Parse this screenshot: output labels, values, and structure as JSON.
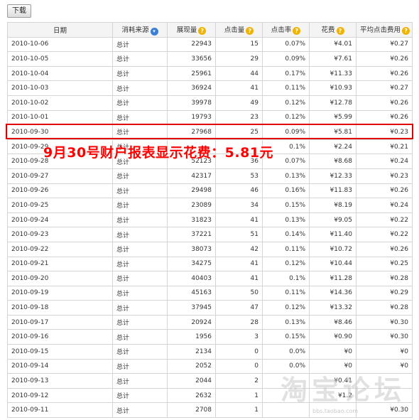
{
  "toolbar": {
    "download_label": "下载"
  },
  "table": {
    "headers": {
      "date": "日期",
      "source": "消耗来源",
      "impressions": "展现量",
      "clicks": "点击量",
      "ctr": "点击率",
      "cost": "花费",
      "avg_cpc": "平均点击费用"
    },
    "rows": [
      {
        "date": "2010-10-06",
        "source": "总计",
        "impressions": "22943",
        "clicks": "15",
        "ctr": "0.07%",
        "cost": "¥4.01",
        "avg_cpc": "¥0.27"
      },
      {
        "date": "2010-10-05",
        "source": "总计",
        "impressions": "33656",
        "clicks": "29",
        "ctr": "0.09%",
        "cost": "¥7.61",
        "avg_cpc": "¥0.26"
      },
      {
        "date": "2010-10-04",
        "source": "总计",
        "impressions": "25961",
        "clicks": "44",
        "ctr": "0.17%",
        "cost": "¥11.33",
        "avg_cpc": "¥0.26"
      },
      {
        "date": "2010-10-03",
        "source": "总计",
        "impressions": "36924",
        "clicks": "41",
        "ctr": "0.11%",
        "cost": "¥10.93",
        "avg_cpc": "¥0.27"
      },
      {
        "date": "2010-10-02",
        "source": "总计",
        "impressions": "39978",
        "clicks": "49",
        "ctr": "0.12%",
        "cost": "¥12.78",
        "avg_cpc": "¥0.26"
      },
      {
        "date": "2010-10-01",
        "source": "总计",
        "impressions": "19793",
        "clicks": "23",
        "ctr": "0.12%",
        "cost": "¥5.99",
        "avg_cpc": "¥0.26"
      },
      {
        "date": "2010-09-30",
        "source": "总计",
        "impressions": "27968",
        "clicks": "25",
        "ctr": "0.09%",
        "cost": "¥5.81",
        "avg_cpc": "¥0.23"
      },
      {
        "date": "2010-09-29",
        "source": "总计",
        "impressions": "",
        "clicks": "",
        "ctr": "0.1%",
        "cost": "¥2.24",
        "avg_cpc": "¥0.21"
      },
      {
        "date": "2010-09-28",
        "source": "总计",
        "impressions": "52123",
        "clicks": "36",
        "ctr": "0.07%",
        "cost": "¥8.68",
        "avg_cpc": "¥0.24"
      },
      {
        "date": "2010-09-27",
        "source": "总计",
        "impressions": "42317",
        "clicks": "53",
        "ctr": "0.13%",
        "cost": "¥12.33",
        "avg_cpc": "¥0.23"
      },
      {
        "date": "2010-09-26",
        "source": "总计",
        "impressions": "29498",
        "clicks": "46",
        "ctr": "0.16%",
        "cost": "¥11.83",
        "avg_cpc": "¥0.26"
      },
      {
        "date": "2010-09-25",
        "source": "总计",
        "impressions": "23089",
        "clicks": "34",
        "ctr": "0.15%",
        "cost": "¥8.19",
        "avg_cpc": "¥0.24"
      },
      {
        "date": "2010-09-24",
        "source": "总计",
        "impressions": "31823",
        "clicks": "41",
        "ctr": "0.13%",
        "cost": "¥9.05",
        "avg_cpc": "¥0.22"
      },
      {
        "date": "2010-09-23",
        "source": "总计",
        "impressions": "37221",
        "clicks": "51",
        "ctr": "0.14%",
        "cost": "¥11.40",
        "avg_cpc": "¥0.22"
      },
      {
        "date": "2010-09-22",
        "source": "总计",
        "impressions": "38073",
        "clicks": "42",
        "ctr": "0.11%",
        "cost": "¥10.72",
        "avg_cpc": "¥0.26"
      },
      {
        "date": "2010-09-21",
        "source": "总计",
        "impressions": "34275",
        "clicks": "41",
        "ctr": "0.12%",
        "cost": "¥10.44",
        "avg_cpc": "¥0.25"
      },
      {
        "date": "2010-09-20",
        "source": "总计",
        "impressions": "40403",
        "clicks": "41",
        "ctr": "0.1%",
        "cost": "¥11.28",
        "avg_cpc": "¥0.28"
      },
      {
        "date": "2010-09-19",
        "source": "总计",
        "impressions": "45163",
        "clicks": "50",
        "ctr": "0.11%",
        "cost": "¥14.36",
        "avg_cpc": "¥0.29"
      },
      {
        "date": "2010-09-18",
        "source": "总计",
        "impressions": "37945",
        "clicks": "47",
        "ctr": "0.12%",
        "cost": "¥13.32",
        "avg_cpc": "¥0.28"
      },
      {
        "date": "2010-09-17",
        "source": "总计",
        "impressions": "20924",
        "clicks": "28",
        "ctr": "0.13%",
        "cost": "¥8.46",
        "avg_cpc": "¥0.30"
      },
      {
        "date": "2010-09-16",
        "source": "总计",
        "impressions": "1956",
        "clicks": "3",
        "ctr": "0.15%",
        "cost": "¥0.90",
        "avg_cpc": "¥0.30"
      },
      {
        "date": "2010-09-15",
        "source": "总计",
        "impressions": "2134",
        "clicks": "0",
        "ctr": "0.0%",
        "cost": "¥0",
        "avg_cpc": "¥0"
      },
      {
        "date": "2010-09-14",
        "source": "总计",
        "impressions": "2052",
        "clicks": "0",
        "ctr": "0.0%",
        "cost": "¥0",
        "avg_cpc": "¥0"
      },
      {
        "date": "2010-09-13",
        "source": "总计",
        "impressions": "2044",
        "clicks": "2",
        "ctr": "",
        "cost": "¥0.41",
        "avg_cpc": ""
      },
      {
        "date": "2010-09-12",
        "source": "总计",
        "impressions": "2632",
        "clicks": "1",
        "ctr": "",
        "cost": "¥1.2",
        "avg_cpc": ""
      },
      {
        "date": "2010-09-11",
        "source": "总计",
        "impressions": "2708",
        "clicks": "1",
        "ctr": "",
        "cost": "",
        "avg_cpc": "¥0.30"
      }
    ]
  },
  "annotation": {
    "text": "9月30号财户报表显示花费：5.81元"
  },
  "watermark": {
    "text": "淘宝论坛",
    "url": "bbs.taobao.com"
  },
  "colors": {
    "highlight": "#e00000",
    "annotation": "#ff0000",
    "help_icon": "#f0b400",
    "sort_icon": "#3b7fd6"
  }
}
